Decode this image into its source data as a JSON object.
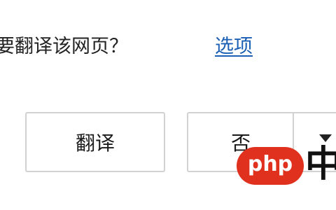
{
  "translate_bar": {
    "prompt": "要翻译该网页？",
    "options_link": "选项",
    "translate_button": "翻译",
    "no_button": "否"
  },
  "watermark": {
    "logo_text": "php",
    "suffix": "中"
  },
  "colors": {
    "link": "#1a5fb4",
    "button_border": "#d2d2d2",
    "watermark_red": "#e0301e"
  },
  "icons": {
    "dropdown": "chevron-down-icon"
  }
}
